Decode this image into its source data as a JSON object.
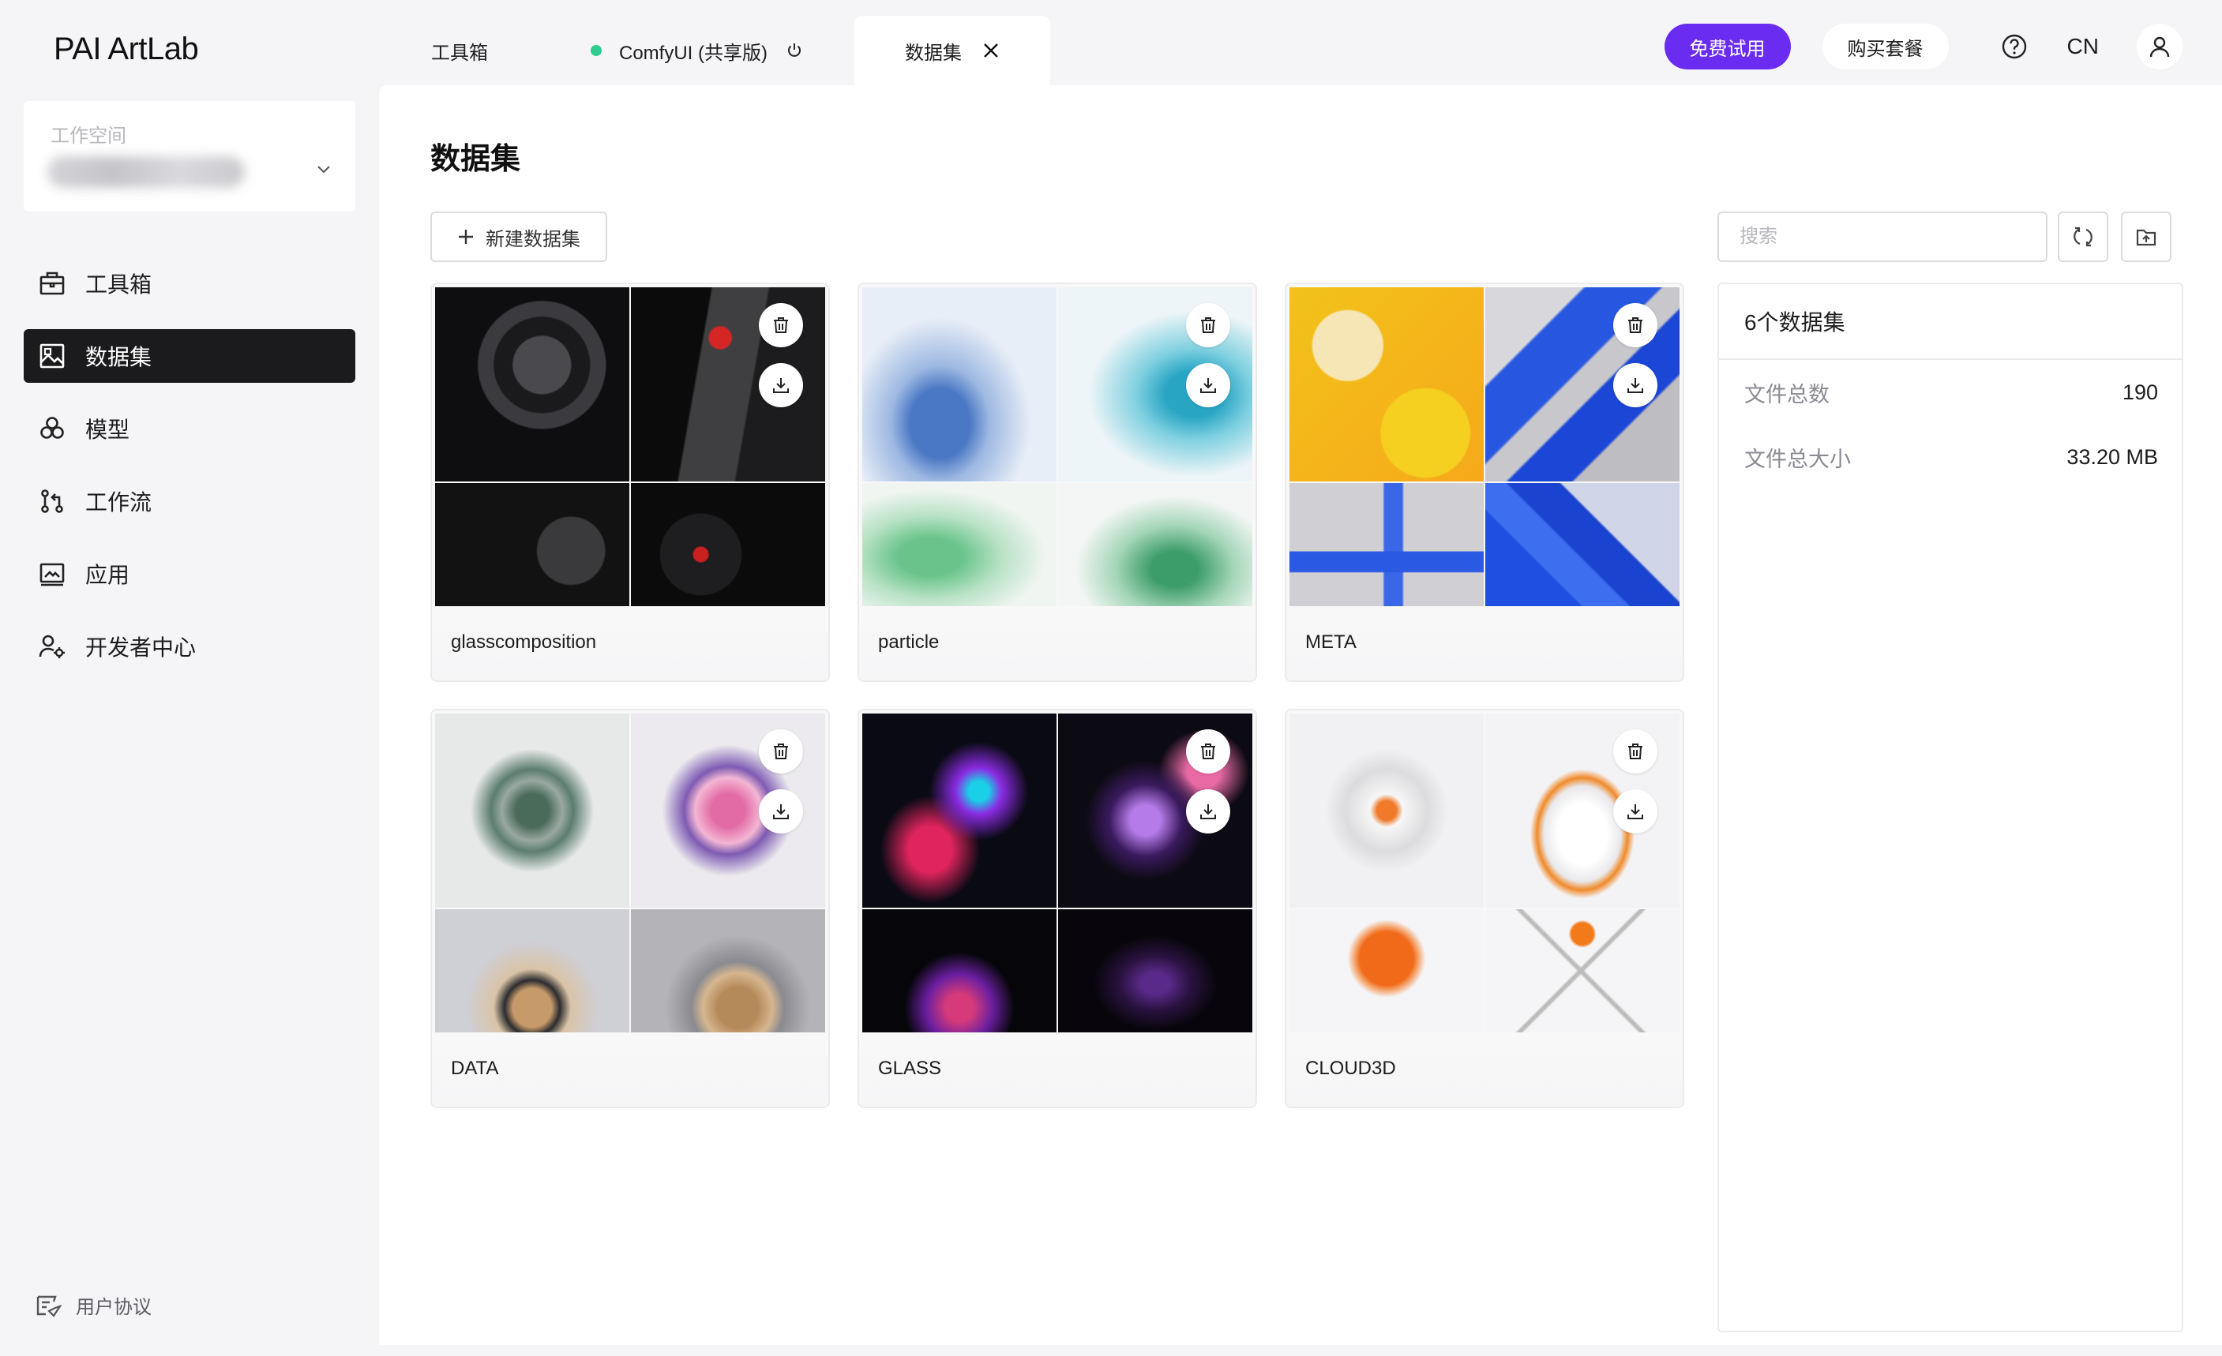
{
  "app": {
    "logo": "PAI ArtLab"
  },
  "workspace": {
    "label": "工作空间"
  },
  "sidebar": {
    "items": [
      {
        "label": "工具箱",
        "icon": "toolbox-icon"
      },
      {
        "label": "数据集",
        "icon": "image-dataset-icon",
        "active": true
      },
      {
        "label": "模型",
        "icon": "model-icon"
      },
      {
        "label": "工作流",
        "icon": "workflow-icon"
      },
      {
        "label": "应用",
        "icon": "app-icon"
      },
      {
        "label": "开发者中心",
        "icon": "developer-icon"
      }
    ],
    "footer": "用户协议"
  },
  "tabs": [
    {
      "label": "工具箱"
    },
    {
      "label": "ComfyUI (共享版)",
      "status_color": "#2ecc8f"
    },
    {
      "label": "数据集",
      "active": true
    }
  ],
  "header": {
    "trial_label": "免费试用",
    "buy_label": "购买套餐",
    "lang": "CN"
  },
  "main": {
    "title": "数据集",
    "new_button": "新建数据集",
    "search_placeholder": "搜索"
  },
  "datasets": [
    {
      "name": "glasscomposition"
    },
    {
      "name": "particle"
    },
    {
      "name": "META"
    },
    {
      "name": "DATA"
    },
    {
      "name": "GLASS"
    },
    {
      "name": "CLOUD3D"
    }
  ],
  "stats": {
    "title": "6个数据集",
    "total_files_label": "文件总数",
    "total_files_value": "190",
    "total_size_label": "文件总大小",
    "total_size_value": "33.20 MB"
  },
  "colors": {
    "accent": "#6a2cf0",
    "active_nav": "#1b1b1d",
    "status_dot": "#2ecc8f"
  }
}
